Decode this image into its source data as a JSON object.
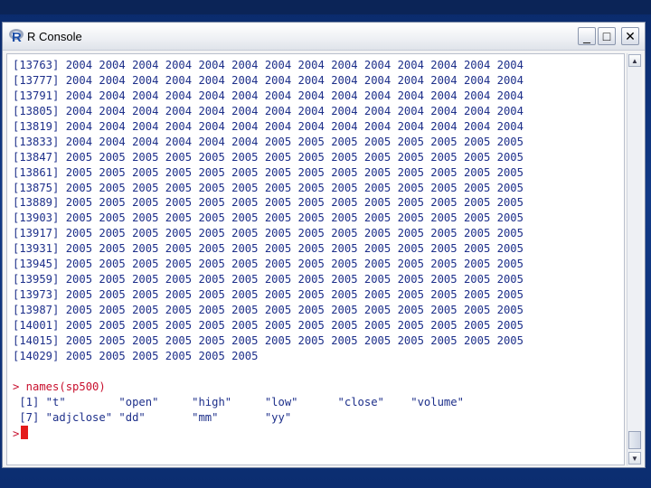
{
  "window": {
    "title": "R Console",
    "controls": {
      "minimize": "_",
      "maximize": "□",
      "close": "✕"
    }
  },
  "console": {
    "lines": [
      {
        "text": "[13763] 2004 2004 2004 2004 2004 2004 2004 2004 2004 2004 2004 2004 2004 2004",
        "kind": "out"
      },
      {
        "text": "[13777] 2004 2004 2004 2004 2004 2004 2004 2004 2004 2004 2004 2004 2004 2004",
        "kind": "out"
      },
      {
        "text": "[13791] 2004 2004 2004 2004 2004 2004 2004 2004 2004 2004 2004 2004 2004 2004",
        "kind": "out"
      },
      {
        "text": "[13805] 2004 2004 2004 2004 2004 2004 2004 2004 2004 2004 2004 2004 2004 2004",
        "kind": "out"
      },
      {
        "text": "[13819] 2004 2004 2004 2004 2004 2004 2004 2004 2004 2004 2004 2004 2004 2004",
        "kind": "out"
      },
      {
        "text": "[13833] 2004 2004 2004 2004 2004 2004 2005 2005 2005 2005 2005 2005 2005 2005",
        "kind": "out"
      },
      {
        "text": "[13847] 2005 2005 2005 2005 2005 2005 2005 2005 2005 2005 2005 2005 2005 2005",
        "kind": "out"
      },
      {
        "text": "[13861] 2005 2005 2005 2005 2005 2005 2005 2005 2005 2005 2005 2005 2005 2005",
        "kind": "out"
      },
      {
        "text": "[13875] 2005 2005 2005 2005 2005 2005 2005 2005 2005 2005 2005 2005 2005 2005",
        "kind": "out"
      },
      {
        "text": "[13889] 2005 2005 2005 2005 2005 2005 2005 2005 2005 2005 2005 2005 2005 2005",
        "kind": "out"
      },
      {
        "text": "[13903] 2005 2005 2005 2005 2005 2005 2005 2005 2005 2005 2005 2005 2005 2005",
        "kind": "out"
      },
      {
        "text": "[13917] 2005 2005 2005 2005 2005 2005 2005 2005 2005 2005 2005 2005 2005 2005",
        "kind": "out"
      },
      {
        "text": "[13931] 2005 2005 2005 2005 2005 2005 2005 2005 2005 2005 2005 2005 2005 2005",
        "kind": "out"
      },
      {
        "text": "[13945] 2005 2005 2005 2005 2005 2005 2005 2005 2005 2005 2005 2005 2005 2005",
        "kind": "out"
      },
      {
        "text": "[13959] 2005 2005 2005 2005 2005 2005 2005 2005 2005 2005 2005 2005 2005 2005",
        "kind": "out"
      },
      {
        "text": "[13973] 2005 2005 2005 2005 2005 2005 2005 2005 2005 2005 2005 2005 2005 2005",
        "kind": "out"
      },
      {
        "text": "[13987] 2005 2005 2005 2005 2005 2005 2005 2005 2005 2005 2005 2005 2005 2005",
        "kind": "out"
      },
      {
        "text": "[14001] 2005 2005 2005 2005 2005 2005 2005 2005 2005 2005 2005 2005 2005 2005",
        "kind": "out"
      },
      {
        "text": "[14015] 2005 2005 2005 2005 2005 2005 2005 2005 2005 2005 2005 2005 2005 2005",
        "kind": "out"
      },
      {
        "text": "[14029] 2005 2005 2005 2005 2005 2005",
        "kind": "out"
      },
      {
        "text": "",
        "kind": "out"
      },
      {
        "text": "> names(sp500)",
        "kind": "cmd"
      },
      {
        "text": " [1] \"t\"        \"open\"     \"high\"     \"low\"      \"close\"    \"volume\"",
        "kind": "out"
      },
      {
        "text": " [7] \"adjclose\" \"dd\"       \"mm\"       \"yy\"",
        "kind": "out"
      }
    ],
    "prompt": ">"
  },
  "colors": {
    "output": "#1d2f8a",
    "command": "#c8102e",
    "cursor": "#e41a1a",
    "desktop": "#123a86"
  },
  "icons": {
    "app": "r-logo-icon"
  }
}
